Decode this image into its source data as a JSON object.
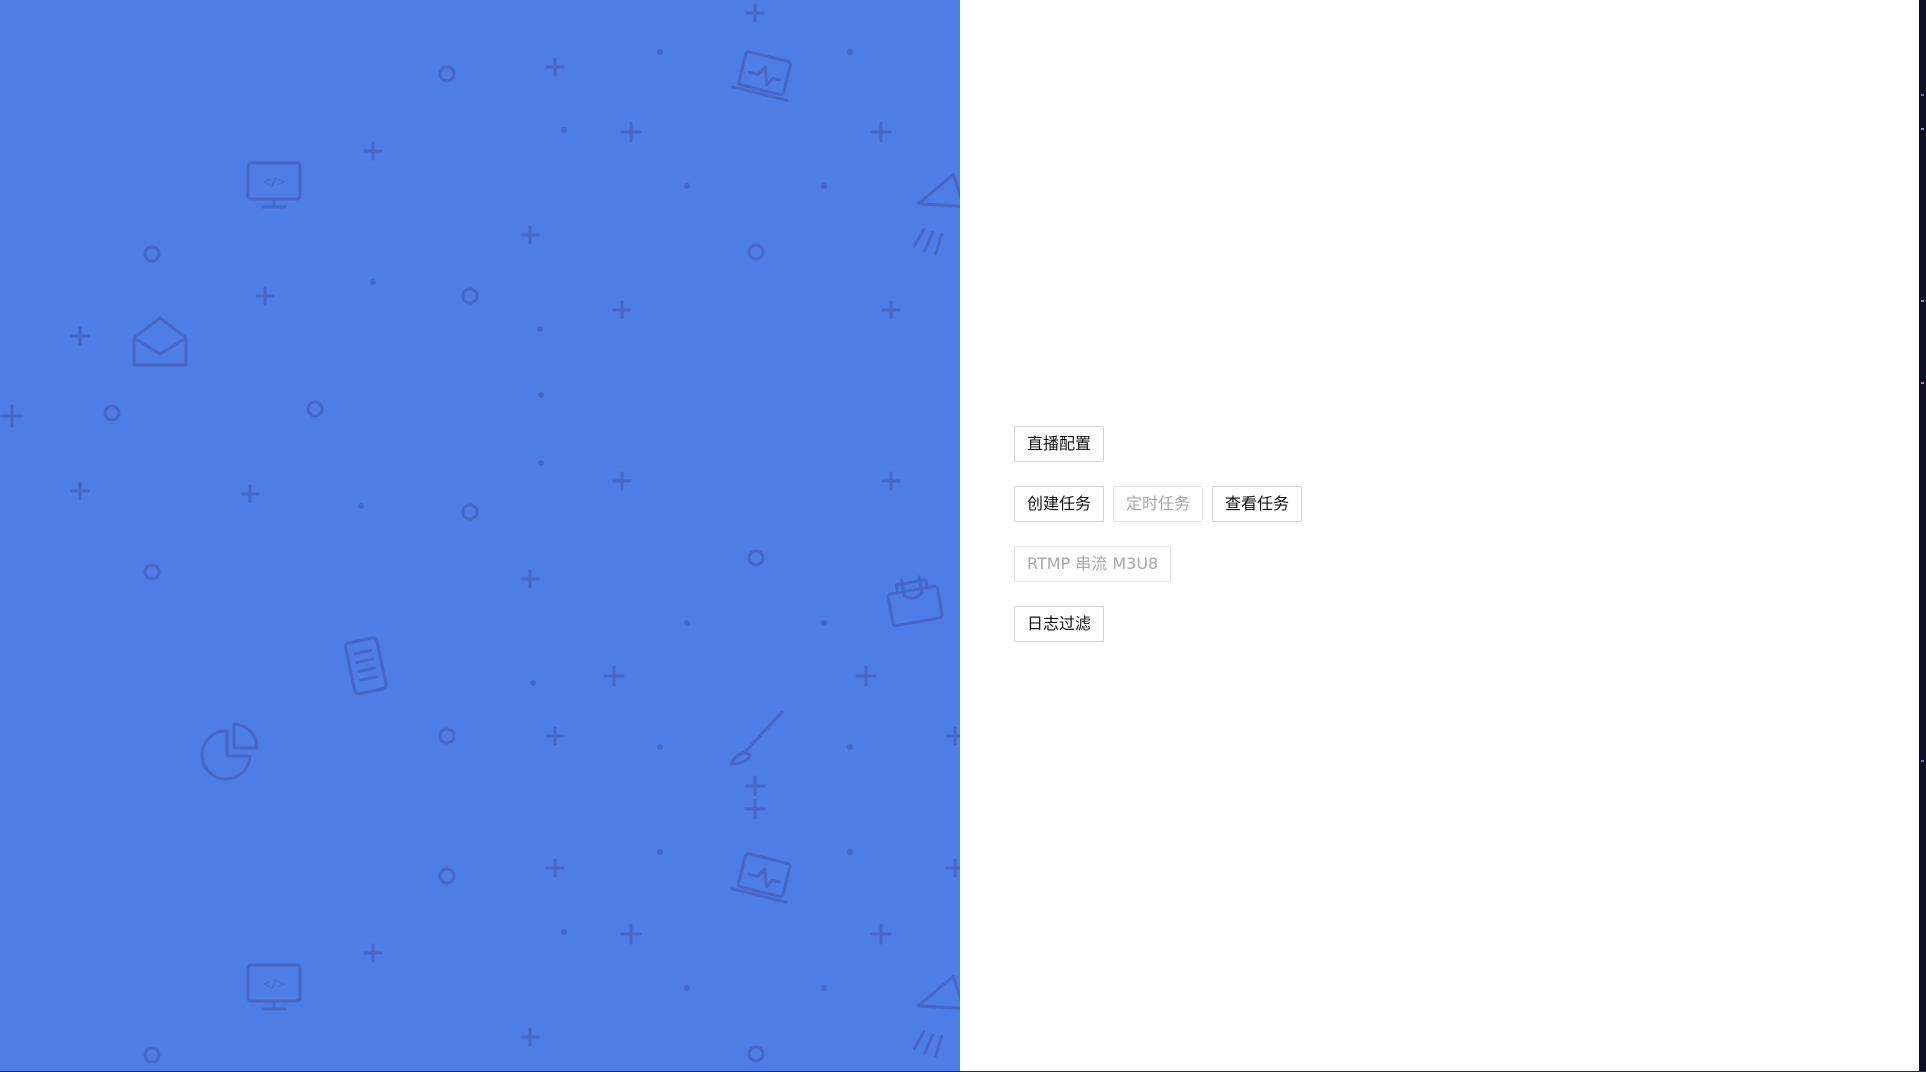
{
  "colors": {
    "left_background": "#4f7de6",
    "pattern_stroke": "#4568c8",
    "button_text": "#111111",
    "disabled_text": "#a8a8a8",
    "button_border": "#d5d5d5"
  },
  "background": {
    "icons": [
      "monitor-code-icon",
      "laptop-chart-icon",
      "envelope-icon",
      "paper-plane-icon",
      "document-icon",
      "pie-chart-icon",
      "paintbrush-icon",
      "padlock-tray-icon"
    ]
  },
  "rows": [
    {
      "buttons": [
        {
          "label": "直播配置",
          "enabled": true
        }
      ]
    },
    {
      "buttons": [
        {
          "label": "创建任务",
          "enabled": true
        },
        {
          "label": "定时任务",
          "enabled": false
        },
        {
          "label": "查看任务",
          "enabled": true
        }
      ]
    },
    {
      "buttons": [
        {
          "label": "RTMP 串流 M3U8",
          "enabled": false
        }
      ]
    },
    {
      "buttons": [
        {
          "label": "日志过滤",
          "enabled": true
        }
      ]
    }
  ]
}
